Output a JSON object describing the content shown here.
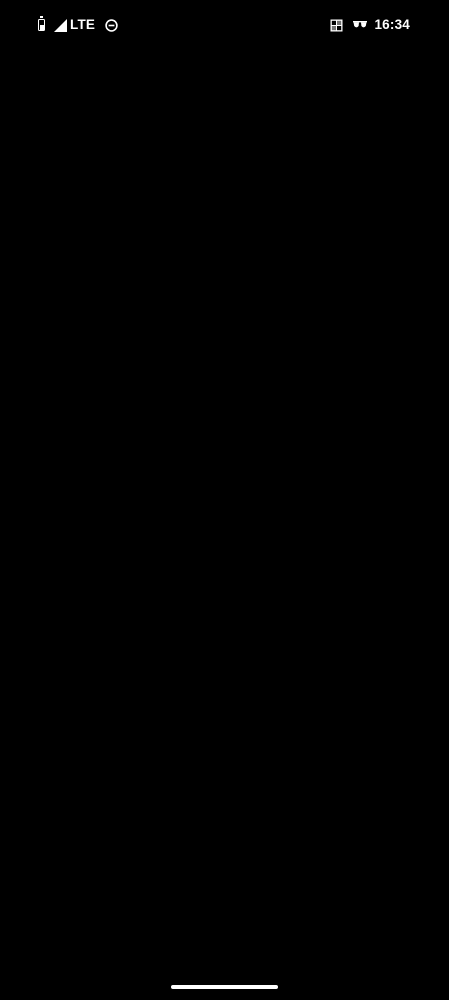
{
  "status_bar": {
    "network_type": "LTE",
    "time": "16:34",
    "icons": [
      "battery-icon",
      "signal-icon",
      "do-not-disturb-icon",
      "app-notification-icon",
      "incognito-icon"
    ]
  },
  "colors": {
    "background": "#000000",
    "foreground": "#ffffff"
  }
}
